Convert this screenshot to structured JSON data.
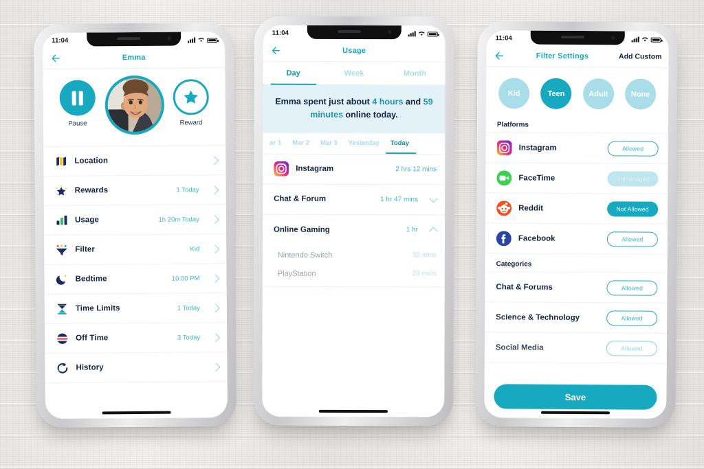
{
  "background": {
    "surface": "whitewashed-wood-planks",
    "color": "#ecebe9"
  },
  "theme": {
    "teal": "#16a9c0",
    "teal_light": "#a9dee9",
    "navy": "#14233f",
    "banner_bg": "#e2f2f6"
  },
  "phone1": {
    "status": {
      "time": "11:04",
      "signal": "signal-bars-icon",
      "wifi": "wifi-icon",
      "battery": "battery-icon"
    },
    "nav": {
      "back": "back-arrow-icon",
      "title": "Emma"
    },
    "hero": {
      "pause_label": "Pause",
      "pause_icon": "pause-icon",
      "avatar": "child-avatar-photo",
      "reward_label": "Reward",
      "reward_icon": "star-icon"
    },
    "menu": [
      {
        "icon": "location-map-icon",
        "label": "Location",
        "value": ""
      },
      {
        "icon": "star-rewards-icon",
        "label": "Rewards",
        "value": "1 Today"
      },
      {
        "icon": "bar-chart-icon",
        "label": "Usage",
        "value": "1h 20m Today"
      },
      {
        "icon": "funnel-filter-icon",
        "label": "Filter",
        "value": "Kid"
      },
      {
        "icon": "moon-icon",
        "label": "Bedtime",
        "value": "10:00 PM"
      },
      {
        "icon": "hourglass-icon",
        "label": "Time Limits",
        "value": "1 Today"
      },
      {
        "icon": "off-time-icon",
        "label": "Off Time",
        "value": "3 Today"
      },
      {
        "icon": "history-icon",
        "label": "History",
        "value": ""
      }
    ]
  },
  "phone2": {
    "status": {
      "time": "11:04"
    },
    "nav": {
      "back": "back-arrow-icon",
      "title": "Usage"
    },
    "period_tabs": [
      {
        "label": "Day",
        "active": true
      },
      {
        "label": "Week",
        "active": false
      },
      {
        "label": "Month",
        "active": false
      }
    ],
    "summary": {
      "part1": "Emma spent just about ",
      "highlight1": "4 hours",
      "part2": " and ",
      "highlight2": "59 minutes",
      "part3": " online today."
    },
    "date_tabs": [
      {
        "label": "ar 1",
        "active": false
      },
      {
        "label": "Mar 2",
        "active": false
      },
      {
        "label": "Mar 3",
        "active": false
      },
      {
        "label": "Yesterday",
        "active": false
      },
      {
        "label": "Today",
        "active": true
      }
    ],
    "usage_rows": [
      {
        "icon": "instagram-icon",
        "label": "Instagram",
        "value": "2 hrs 12 mins",
        "expander": "none"
      },
      {
        "icon": "",
        "label": "Chat & Forum",
        "value": "1 hr 47 mins",
        "expander": "chevron-down-icon"
      },
      {
        "icon": "",
        "label": "Online Gaming",
        "value": "1 hr",
        "expander": "chevron-up-icon"
      }
    ],
    "gaming_children": [
      {
        "label": "Nintendo Switch",
        "value": "35 mins"
      },
      {
        "label": "PlayStation",
        "value": "25 mins"
      }
    ]
  },
  "phone3": {
    "status": {
      "time": "11:04"
    },
    "nav": {
      "back": "back-arrow-icon",
      "title": "Filter Settings",
      "action": "Add Custom"
    },
    "age_pills": [
      {
        "label": "Kid",
        "active": false
      },
      {
        "label": "Teen",
        "active": true
      },
      {
        "label": "Adult",
        "active": false
      },
      {
        "label": "None",
        "active": false
      }
    ],
    "platforms_header": "Platforms",
    "platforms": [
      {
        "icon": "instagram-icon",
        "label": "Instagram",
        "status": "Allowed",
        "state": "allowed"
      },
      {
        "icon": "facetime-icon",
        "label": "FaceTime",
        "status": "Unmanaged",
        "state": "unmanaged"
      },
      {
        "icon": "reddit-icon",
        "label": "Reddit",
        "status": "Not Allowed",
        "state": "notallowed"
      },
      {
        "icon": "facebook-icon",
        "label": "Facebook",
        "status": "Allowed",
        "state": "allowed"
      }
    ],
    "categories_header": "Categories",
    "categories": [
      {
        "label": "Chat & Forums",
        "status": "Allowed",
        "state": "allowed"
      },
      {
        "label": "Science & Technology",
        "status": "Allowed",
        "state": "allowed"
      },
      {
        "label": "Social Media",
        "status": "Allowed",
        "state": "allowed"
      }
    ],
    "save_label": "Save"
  }
}
